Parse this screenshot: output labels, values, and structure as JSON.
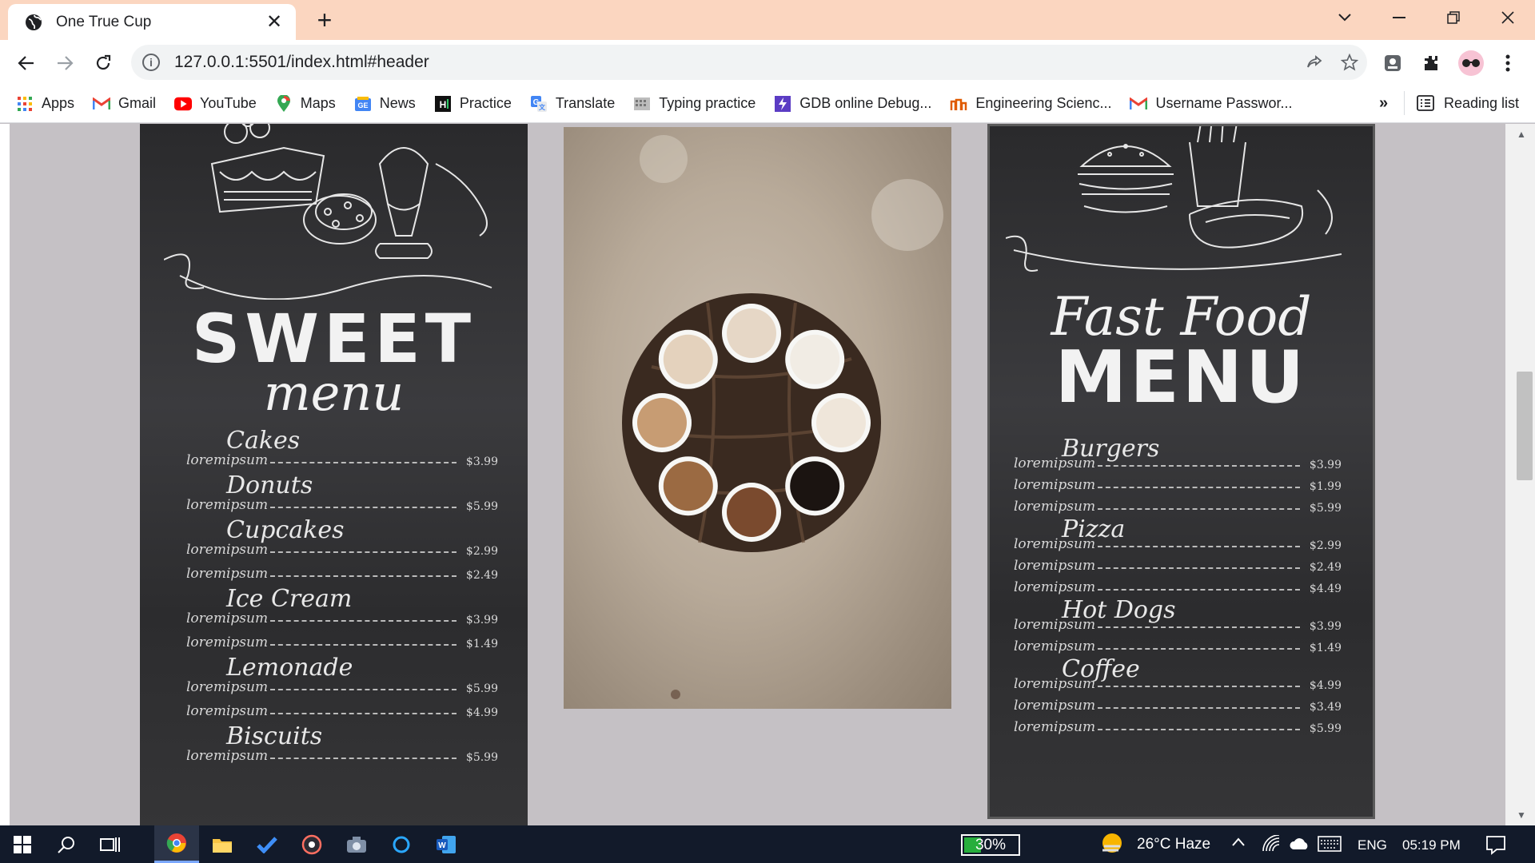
{
  "browser": {
    "tab": {
      "title": "One True Cup"
    },
    "url": "127.0.0.1:5501/index.html#header",
    "bookmarks": [
      {
        "label": "Apps",
        "icon": "apps-grid-icon",
        "color": "#ea4335"
      },
      {
        "label": "Gmail",
        "icon": "gmail-icon",
        "color": "#ea4335"
      },
      {
        "label": "YouTube",
        "icon": "youtube-icon",
        "color": "#ff0000"
      },
      {
        "label": "Maps",
        "icon": "maps-pin-icon",
        "color": "#34a853"
      },
      {
        "label": "News",
        "icon": "google-news-icon",
        "color": "#4285f4"
      },
      {
        "label": "Practice",
        "icon": "hackerrank-icon",
        "color": "#111111"
      },
      {
        "label": "Translate",
        "icon": "translate-icon",
        "color": "#4285f4"
      },
      {
        "label": "Typing practice",
        "icon": "typing-icon",
        "color": "#777777"
      },
      {
        "label": "GDB online Debug...",
        "icon": "gdb-icon",
        "color": "#5b3cc4"
      },
      {
        "label": "Engineering Scienc...",
        "icon": "engineering-icon",
        "color": "#e05a00"
      },
      {
        "label": "Username Passwor...",
        "icon": "gmail-icon",
        "color": "#ea4335"
      }
    ],
    "bookmarks_overflow": "»",
    "reading_list": "Reading list"
  },
  "page": {
    "sweet_menu": {
      "heading": "SWEET",
      "subheading": "menu",
      "sections": [
        {
          "title": "Cakes",
          "rows": [
            {
              "item": "loremipsum",
              "price": "$3.99"
            }
          ]
        },
        {
          "title": "Donuts",
          "rows": [
            {
              "item": "loremipsum",
              "price": "$5.99"
            }
          ]
        },
        {
          "title": "Cupcakes",
          "rows": [
            {
              "item": "loremipsum",
              "price": "$2.99"
            },
            {
              "item": "loremipsum",
              "price": "$2.49"
            }
          ]
        },
        {
          "title": "Ice Cream",
          "rows": [
            {
              "item": "loremipsum",
              "price": "$3.99"
            },
            {
              "item": "loremipsum",
              "price": "$1.49"
            }
          ]
        },
        {
          "title": "Lemonade",
          "rows": [
            {
              "item": "loremipsum",
              "price": "$5.99"
            },
            {
              "item": "loremipsum",
              "price": "$4.99"
            }
          ]
        },
        {
          "title": "Biscuits",
          "rows": [
            {
              "item": "loremipsum",
              "price": "$5.99"
            }
          ]
        }
      ]
    },
    "fast_menu": {
      "heading_script": "Fast Food",
      "heading": "MENU",
      "sections": [
        {
          "title": "Burgers",
          "rows": [
            {
              "item": "loremipsum",
              "price": "$3.99"
            },
            {
              "item": "loremipsum",
              "price": "$1.99"
            },
            {
              "item": "loremipsum",
              "price": "$5.99"
            }
          ]
        },
        {
          "title": "Pizza",
          "rows": [
            {
              "item": "loremipsum",
              "price": "$2.99"
            },
            {
              "item": "loremipsum",
              "price": "$2.49"
            },
            {
              "item": "loremipsum",
              "price": "$4.49"
            }
          ]
        },
        {
          "title": "Hot Dogs",
          "rows": [
            {
              "item": "loremipsum",
              "price": "$3.99"
            },
            {
              "item": "loremipsum",
              "price": "$1.49"
            }
          ]
        },
        {
          "title": "Coffee",
          "rows": [
            {
              "item": "loremipsum",
              "price": "$4.99"
            },
            {
              "item": "loremipsum",
              "price": "$3.49"
            },
            {
              "item": "loremipsum",
              "price": "$5.99"
            }
          ]
        }
      ]
    },
    "coffee_photo": {
      "cups": 8
    }
  },
  "taskbar": {
    "battery": "30%",
    "battery_level": 0.3,
    "weather": "26°C  Haze",
    "language": "ENG",
    "time": "05:19 PM"
  }
}
